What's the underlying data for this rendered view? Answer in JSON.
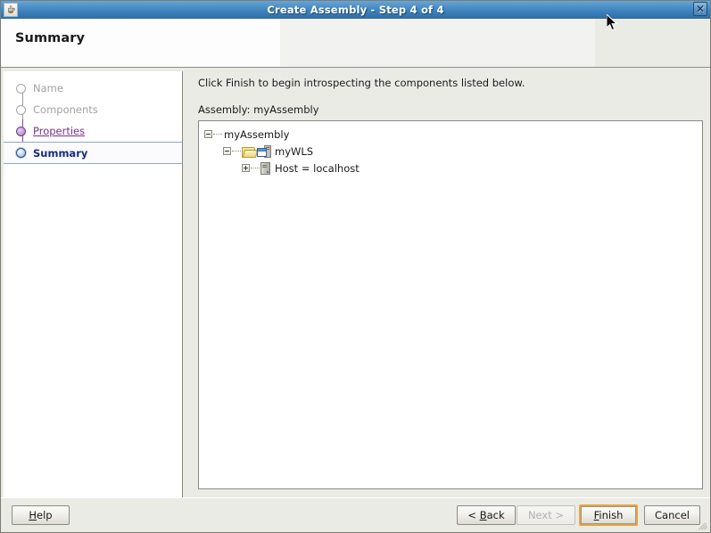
{
  "window": {
    "title": "Create Assembly - Step 4 of 4",
    "app_icon": "java-coffee-cup-icon",
    "close_label": "✕"
  },
  "header": {
    "title": "Summary"
  },
  "sidebar": {
    "steps": [
      {
        "label": "Name",
        "state": "pending"
      },
      {
        "label": "Components",
        "state": "pending"
      },
      {
        "label": "Properties",
        "state": "visited"
      },
      {
        "label": "Summary",
        "state": "current"
      }
    ]
  },
  "main": {
    "instruction": "Click Finish to begin introspecting the components listed below.",
    "assembly_label": "Assembly: myAssembly",
    "tree": [
      {
        "label": "myAssembly",
        "level": 1,
        "handle": "minus",
        "icons": []
      },
      {
        "label": "myWLS",
        "level": 2,
        "handle": "minus",
        "icons": [
          "folder-open-icon",
          "server-window-icon"
        ]
      },
      {
        "label": "Host = localhost",
        "level": 3,
        "handle": "plus",
        "icons": [
          "server-icon"
        ]
      }
    ]
  },
  "footer": {
    "buttons": [
      {
        "name": "help",
        "label": "Help",
        "mnemonic": "H",
        "state": "enabled"
      },
      {
        "name": "back",
        "label": "< Back",
        "mnemonic": "B",
        "state": "enabled"
      },
      {
        "name": "next",
        "label": "Next >",
        "mnemonic": "N",
        "state": "disabled"
      },
      {
        "name": "finish",
        "label": "Finish",
        "mnemonic": "F",
        "state": "default"
      },
      {
        "name": "cancel",
        "label": "Cancel",
        "mnemonic": "",
        "state": "enabled"
      }
    ]
  },
  "colors": {
    "titlebar": "#3b7fba",
    "dialog_bg": "#ebebe6",
    "panel_bg": "#ffffff",
    "current_step_text": "#172a7a",
    "visited_step_link": "#7d2f8f",
    "pending_step_text": "#a3a3a0",
    "default_button_focus": "#e8a33d"
  }
}
